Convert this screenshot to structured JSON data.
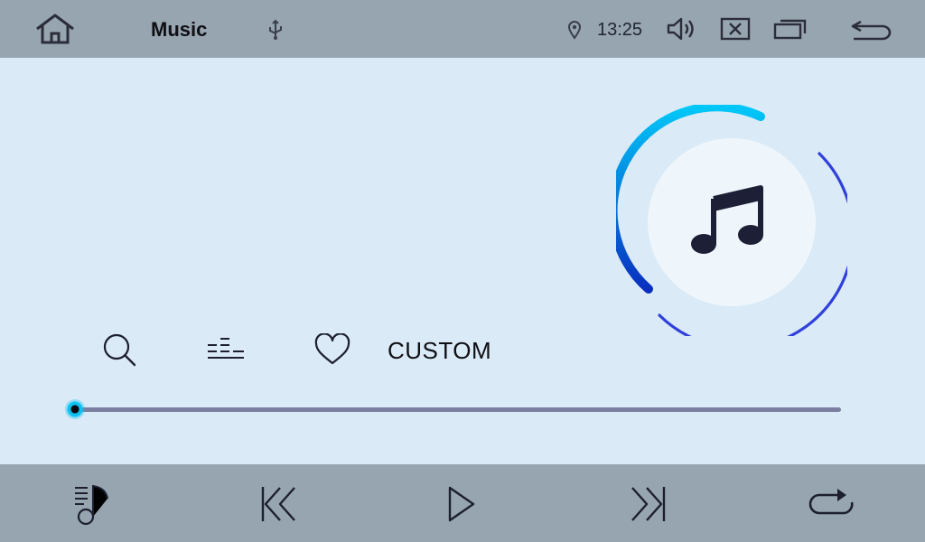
{
  "status_bar": {
    "title": "Music",
    "time": "13:25",
    "icons": {
      "home": "home-icon",
      "usb": "usb-icon",
      "location": "location-pin-icon",
      "volume": "volume-icon",
      "close": "close-box-icon",
      "windows": "recent-apps-icon",
      "back": "back-arrow-icon"
    }
  },
  "toolbar": {
    "mode_label": "CUSTOM",
    "icons": {
      "search": "search-icon",
      "equalizer": "equalizer-icon",
      "favorite": "heart-icon"
    }
  },
  "progress": {
    "value": 0
  },
  "controls": {
    "icons": {
      "playlist": "playlist-icon",
      "previous": "previous-track-icon",
      "play": "play-icon",
      "next": "next-track-icon",
      "repeat": "repeat-icon"
    }
  },
  "album_art": {
    "icon": "music-note-icon"
  },
  "colors": {
    "top_bar": "#97a5b0",
    "main_bg": "#daeaf6",
    "accent_cyan": "#00c3f5",
    "accent_blue": "#2f3fd9",
    "icon_dark": "#1c1f35"
  }
}
